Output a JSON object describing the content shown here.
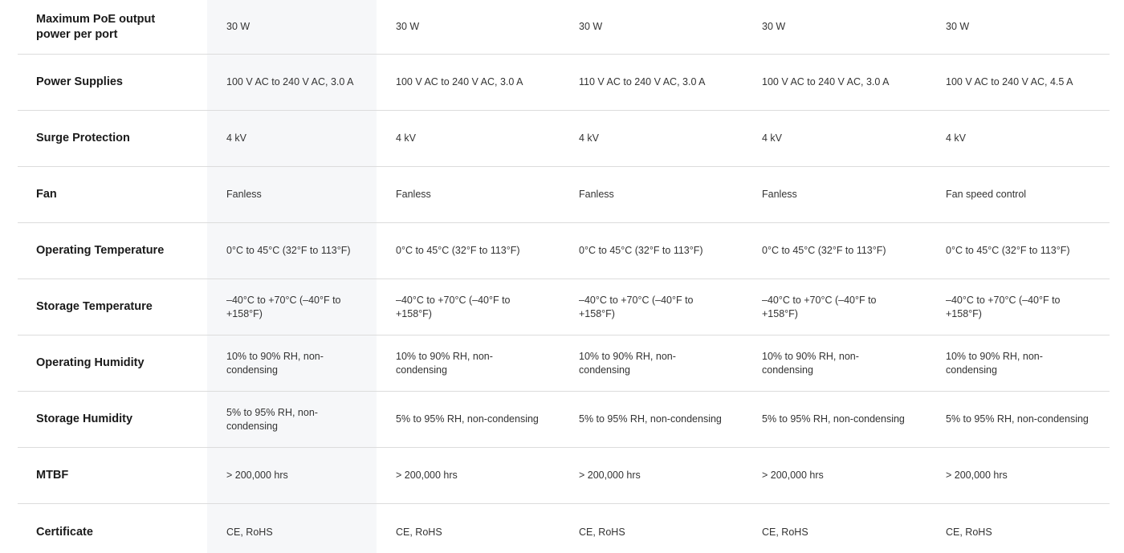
{
  "rows": [
    {
      "label": "Maximum PoE output power per port",
      "values": [
        "30 W",
        "30 W",
        "30 W",
        "30 W",
        "30 W"
      ]
    },
    {
      "label": "Power Supplies",
      "values": [
        "100 V AC to 240 V AC, 3.0 A",
        "100 V AC to 240 V AC, 3.0 A",
        "110 V AC to 240 V AC, 3.0 A",
        "100 V AC to 240 V AC, 3.0 A",
        "100 V AC to 240 V AC, 4.5 A"
      ]
    },
    {
      "label": "Surge Protection",
      "values": [
        "4 kV",
        "4 kV",
        "4 kV",
        "4 kV",
        "4 kV"
      ]
    },
    {
      "label": "Fan",
      "values": [
        "Fanless",
        "Fanless",
        "Fanless",
        "Fanless",
        "Fan speed control"
      ]
    },
    {
      "label": "Operating Temperature",
      "values": [
        "0°C to 45°C (32°F to 113°F)",
        "0°C to 45°C (32°F to 113°F)",
        "0°C to 45°C (32°F to 113°F)",
        "0°C to 45°C (32°F to 113°F)",
        "0°C to 45°C (32°F to 113°F)"
      ]
    },
    {
      "label": "Storage Temperature",
      "values": [
        "–40°C to +70°C (–40°F to +158°F)",
        "–40°C to +70°C (–40°F to +158°F)",
        "–40°C to +70°C (–40°F to +158°F)",
        "–40°C to +70°C (–40°F to +158°F)",
        "–40°C to +70°C (–40°F to +158°F)"
      ]
    },
    {
      "label": "Operating Humidity",
      "values": [
        "10% to 90% RH, non-condensing",
        "10% to 90% RH, non-condensing",
        "10% to 90% RH, non-condensing",
        "10% to 90% RH, non-condensing",
        "10% to 90% RH, non-condensing"
      ]
    },
    {
      "label": "Storage Humidity",
      "values": [
        "5% to 95% RH, non-condensing",
        "5% to 95% RH, non-condensing",
        "5% to 95% RH, non-condensing",
        "5% to 95% RH, non-condensing",
        "5% to 95% RH, non-condensing"
      ]
    },
    {
      "label": "MTBF",
      "values": [
        "> 200,000 hrs",
        "> 200,000 hrs",
        "> 200,000 hrs",
        "> 200,000 hrs",
        "> 200,000 hrs"
      ]
    },
    {
      "label": "Certificate",
      "values": [
        "CE, RoHS",
        "CE, RoHS",
        "CE, RoHS",
        "CE, RoHS",
        "CE, RoHS"
      ]
    }
  ],
  "colors": {
    "highlight_column": "#f6f7f9",
    "divider": "#dcdcdc",
    "label_text": "#1a1a1a",
    "value_text": "#333333"
  }
}
